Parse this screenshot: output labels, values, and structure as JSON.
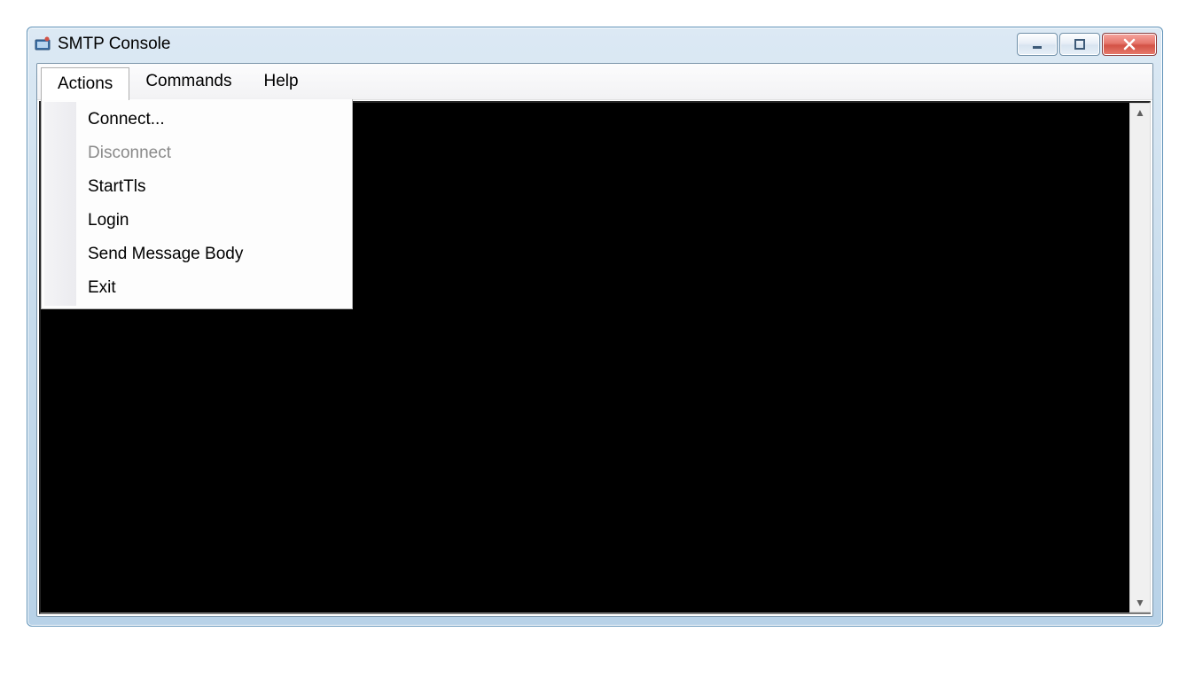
{
  "window": {
    "title": "SMTP Console"
  },
  "menubar": {
    "items": [
      {
        "label": "Actions",
        "active": true
      },
      {
        "label": "Commands",
        "active": false
      },
      {
        "label": "Help",
        "active": false
      }
    ]
  },
  "actions_menu": {
    "items": [
      {
        "label": "Connect...",
        "enabled": true
      },
      {
        "label": "Disconnect",
        "enabled": false
      },
      {
        "label": "StartTls",
        "enabled": true
      },
      {
        "label": "Login",
        "enabled": true
      },
      {
        "label": "Send Message Body",
        "enabled": true
      },
      {
        "label": "Exit",
        "enabled": true
      }
    ]
  },
  "icons": {
    "minimize": "minimize-icon",
    "maximize": "maximize-icon",
    "close": "close-icon"
  },
  "colors": {
    "titlebar_gradient_top": "#dce9f4",
    "titlebar_gradient_bottom": "#b8d2e8",
    "console_bg": "#000000",
    "close_button": "#d35246"
  }
}
